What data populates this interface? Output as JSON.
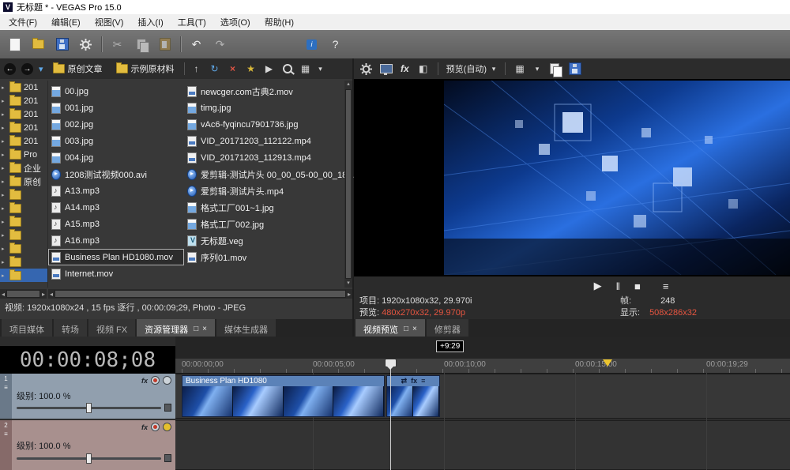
{
  "window": {
    "icon_letter": "V",
    "title": "无标题 * - VEGAS Pro 15.0"
  },
  "menu": {
    "items": [
      "文件(F)",
      "编辑(E)",
      "视图(V)",
      "插入(I)",
      "工具(T)",
      "选项(O)",
      "帮助(H)"
    ]
  },
  "ui": {
    "tab_float_glyph": "□",
    "tab_close_glyph": "×"
  },
  "icons": {
    "cut": "✂",
    "undo": "↶",
    "redo": "↷",
    "tutorials": "i",
    "help": "?",
    "nav_back": "←",
    "nav_forward": "→",
    "caret": "▾",
    "folder_up": "↑",
    "refresh": "↻",
    "delete": "×",
    "favorites": "★",
    "play_preview": "▶",
    "views": "▦",
    "fx": "fx",
    "split": "◧",
    "transport_play": "▶",
    "transport_pause": "‖",
    "transport_stop": "■",
    "transport_menu": "≡",
    "event_pan": "⇄",
    "event_fx": "fx",
    "event_menu": "≡",
    "track_menu": "≡",
    "expander": "▸",
    "scroll_left": "◂",
    "scroll_right": "▸",
    "scroll_up": "▴",
    "scroll_down": "▾"
  },
  "explorer": {
    "folder_tabs": [
      {
        "label": "原创文章"
      },
      {
        "label": "示例原材料"
      }
    ],
    "tree": [
      {
        "label": "201"
      },
      {
        "label": "201"
      },
      {
        "label": "201"
      },
      {
        "label": "201"
      },
      {
        "label": "201"
      },
      {
        "label": "Pro"
      },
      {
        "label": "企业"
      },
      {
        "label": "原创"
      },
      {
        "label": ""
      },
      {
        "label": ""
      },
      {
        "label": ""
      },
      {
        "label": ""
      },
      {
        "label": ""
      },
      {
        "label": ""
      },
      {
        "label": "",
        "selected": true
      }
    ],
    "files_col1": [
      {
        "name": "00.jpg",
        "type": "image"
      },
      {
        "name": "001.jpg",
        "type": "image"
      },
      {
        "name": "002.jpg",
        "type": "image"
      },
      {
        "name": "003.jpg",
        "type": "image"
      },
      {
        "name": "004.jpg",
        "type": "image"
      },
      {
        "name": "1208测试视频000.avi",
        "type": "player"
      },
      {
        "name": "A13.mp3",
        "type": "audio"
      },
      {
        "name": "A14.mp3",
        "type": "audio"
      },
      {
        "name": "A15.mp3",
        "type": "audio"
      },
      {
        "name": "A16.mp3",
        "type": "audio"
      },
      {
        "name": "Business Plan HD1080.mov",
        "type": "video",
        "selected": true
      },
      {
        "name": "Internet.mov",
        "type": "video"
      }
    ],
    "files_col2": [
      {
        "name": "newcger.com古典2.mov",
        "type": "video"
      },
      {
        "name": "timg.jpg",
        "type": "image"
      },
      {
        "name": "vAc6-fyqincu7901736.jpg",
        "type": "image"
      },
      {
        "name": "VID_20171203_112122.mp4",
        "type": "video"
      },
      {
        "name": "VID_20171203_112913.mp4",
        "type": "video"
      },
      {
        "name": "爱剪辑-测试片头 00_00_05-00_00_18…",
        "type": "player"
      },
      {
        "name": "爱剪辑-测试片头.mp4",
        "type": "player"
      },
      {
        "name": "格式工厂001~1.jpg",
        "type": "image"
      },
      {
        "name": "格式工厂002.jpg",
        "type": "image"
      },
      {
        "name": "无标题.veg",
        "type": "veg"
      },
      {
        "name": "序列01.mov",
        "type": "video"
      }
    ],
    "status": "视频: 1920x1080x24 , 15 fps 逐行 , 00:00:09;29, Photo - JPEG",
    "tabs": [
      {
        "label": "项目媒体"
      },
      {
        "label": "转场"
      },
      {
        "label": "视频 FX"
      },
      {
        "label": "资源管理器",
        "active": true
      },
      {
        "label": "媒体生成器"
      }
    ]
  },
  "preview": {
    "quality_dropdown": "预览(自动)",
    "info": {
      "project_label": "项目:",
      "project_value": "1920x1080x32, 29.970i",
      "preview_label": "预览:",
      "preview_value": "480x270x32, 29.970p",
      "frame_label": "帧:",
      "frame_value": "248",
      "display_label": "显示:",
      "display_value": "508x286x32"
    },
    "tabs": [
      {
        "label": "视频预览",
        "active": true
      },
      {
        "label": "修剪器"
      }
    ]
  },
  "timeline": {
    "timecode": "00:00:08;08",
    "marker_badge": "+9:29",
    "ruler_labels": [
      "00:00:00;00",
      "00:00:05;00",
      "00:00:10;00",
      "00:00:15;00",
      "00:00:19;29"
    ],
    "clip_name": "Business Plan HD1080",
    "tracks": [
      {
        "number": "1",
        "level": "级别: 100.0 %"
      },
      {
        "number": "2",
        "level": "级别: 100.0 %"
      }
    ]
  }
}
